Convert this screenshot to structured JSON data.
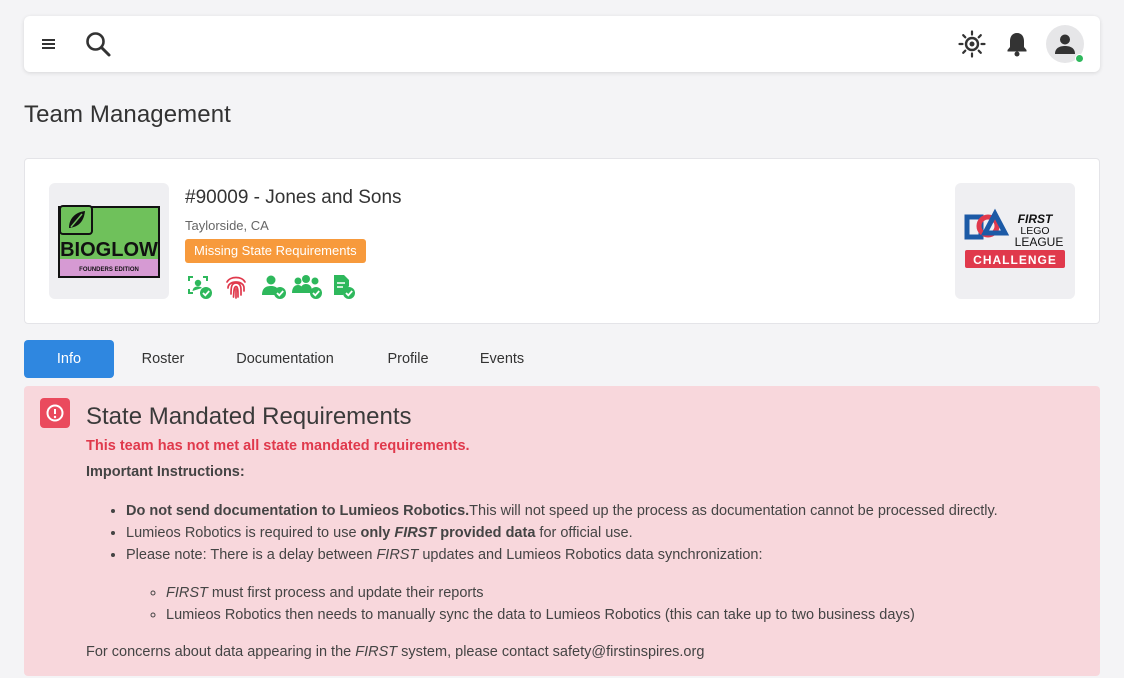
{
  "page": {
    "title": "Team Management"
  },
  "team": {
    "name": "#90009 - Jones and Sons",
    "location": "Taylorside, CA",
    "badge": "Missing State Requirements",
    "logo": {
      "title": "BIOGLOW",
      "subtitle": "FOUNDERS EDITION"
    },
    "status_icons": [
      "face-check-icon",
      "fingerprint-icon",
      "person-check-icon",
      "group-check-icon",
      "document-check-icon"
    ]
  },
  "program_logo": {
    "line1": "FIRST",
    "line2": "LEGO",
    "line3": "LEAGUE",
    "banner": "CHALLENGE"
  },
  "tabs": [
    {
      "label": "Info",
      "active": true
    },
    {
      "label": "Roster",
      "active": false
    },
    {
      "label": "Documentation",
      "active": false
    },
    {
      "label": "Profile",
      "active": false
    },
    {
      "label": "Events",
      "active": false
    }
  ],
  "alert": {
    "title": "State Mandated Requirements",
    "subtitle": "This team has not met all state mandated requirements.",
    "instructions_label": "Important Instructions:",
    "items": {
      "one_bold": "Do not send documentation to Lumieos Robotics.",
      "one_rest": "This will not speed up the process as documentation cannot be processed directly.",
      "two_a": "Lumieos Robotics is required to use ",
      "two_b": "only ",
      "two_c": "FIRST",
      "two_d": " provided data",
      "two_e": " for official use.",
      "three_a": "Please note: There is a delay between ",
      "three_b": "FIRST",
      "three_c": " updates and Lumieos Robotics data synchronization:"
    },
    "subitems": {
      "one_a": "FIRST",
      "one_b": " must first process and update their reports",
      "two": "Lumieos Robotics then needs to manually sync the data to Lumieos Robotics (this can take up to two business days)"
    },
    "footer": {
      "a": "For concerns about data appearing in the ",
      "b": "FIRST",
      "c": " system, please contact safety@firstinspires.org"
    }
  },
  "colors": {
    "accent": "#2f87e0",
    "warning": "#f79a3c",
    "danger": "#ea4a5d",
    "success": "#2eb85c",
    "alert_bg": "#f8d7dc"
  }
}
